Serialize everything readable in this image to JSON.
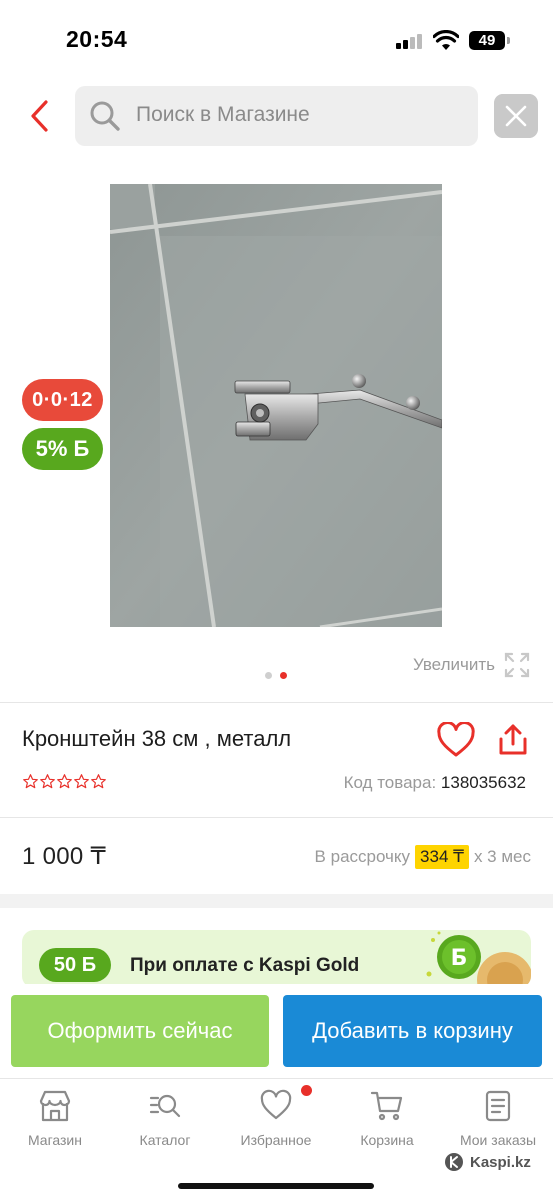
{
  "status": {
    "time": "20:54",
    "battery": "49"
  },
  "search": {
    "placeholder": "Поиск в Магазине"
  },
  "badges": {
    "installment": "0·0·12",
    "bonus": "5% Б"
  },
  "gallery": {
    "zoom_label": "Увеличить",
    "total_images": 2,
    "active_index": 1
  },
  "product": {
    "title": "Кронштейн 38 см , металл",
    "code_label": "Код товара:",
    "code_value": "138035632",
    "rating_stars": 0,
    "price": "1 000 ₸",
    "installment_prefix": "В рассрочку",
    "installment_amount": "334 ₸",
    "installment_suffix": "х 3 мес"
  },
  "gold_banner": {
    "badge": "50 Б",
    "text": "При оплате с Kaspi Gold"
  },
  "actions": {
    "buy_now": "Оформить сейчас",
    "add_to_cart": "Добавить в корзину"
  },
  "tabs": [
    {
      "label": "Магазин",
      "icon": "shop-icon"
    },
    {
      "label": "Каталог",
      "icon": "catalog-search-icon"
    },
    {
      "label": "Избранное",
      "icon": "heart-icon"
    },
    {
      "label": "Корзина",
      "icon": "cart-icon"
    },
    {
      "label": "Мои заказы",
      "icon": "orders-icon"
    }
  ],
  "watermark": "Kaspi.kz",
  "colors": {
    "accent_red": "#e8302a",
    "bonus_green": "#58a81e",
    "buy_green": "#97d65e",
    "cart_blue": "#1a8ad6",
    "installment_yellow": "#fed400"
  }
}
